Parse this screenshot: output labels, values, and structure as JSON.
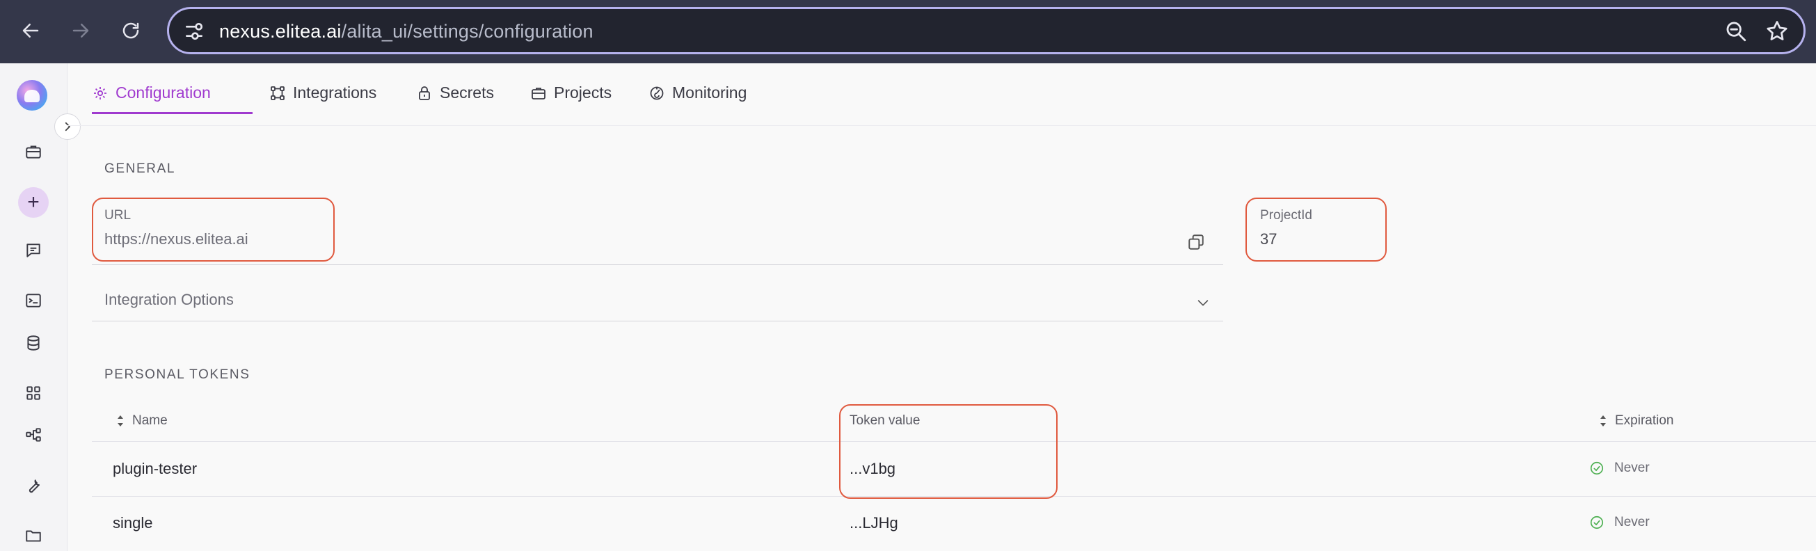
{
  "browser": {
    "url_host": "nexus.elitea.ai",
    "url_path": "/alita_ui/settings/configuration"
  },
  "tabs": [
    {
      "label": "Configuration",
      "icon": "gear-icon",
      "active": true
    },
    {
      "label": "Integrations",
      "icon": "integrations-icon",
      "active": false
    },
    {
      "label": "Secrets",
      "icon": "lock-icon",
      "active": false
    },
    {
      "label": "Projects",
      "icon": "briefcase-icon",
      "active": false
    },
    {
      "label": "Monitoring",
      "icon": "monitoring-icon",
      "active": false
    }
  ],
  "general": {
    "title": "GENERAL",
    "url_label": "URL",
    "url_value": "https://nexus.elitea.ai",
    "project_label": "ProjectId",
    "project_value": "37",
    "integration_options": "Integration Options"
  },
  "tokens": {
    "title": "PERSONAL TOKENS",
    "columns": {
      "name": "Name",
      "token": "Token value",
      "expiration": "Expiration"
    },
    "rows": [
      {
        "name": "plugin-tester",
        "token": "...v1bg",
        "expiration": "Never"
      },
      {
        "name": "single",
        "token": "...LJHg",
        "expiration": "Never"
      }
    ]
  },
  "colors": {
    "accent": "#a03bcf",
    "highlight_box": "#e05a3f",
    "chrome": "#34374a",
    "status_ok": "#4caf50"
  }
}
